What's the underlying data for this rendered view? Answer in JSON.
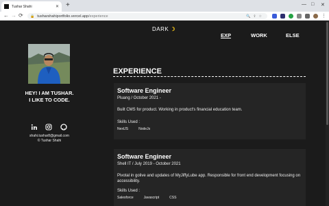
{
  "browser": {
    "tab_title": "Tushar Shahi",
    "tab_close": "✕",
    "new_tab": "+",
    "url_host": "tusharshahiportfolio.vercel.app",
    "url_path": "/experience",
    "back": "←",
    "forward": "→",
    "reload": "⟳"
  },
  "header": {
    "mode_label": "DARK",
    "mode_icon": "☽",
    "nav": [
      {
        "label": "EXP",
        "active": true
      },
      {
        "label": "WORK",
        "active": false
      },
      {
        "label": "ELSE",
        "active": false
      }
    ]
  },
  "profile": {
    "greeting_line1": "HEY! I AM TUSHAR.",
    "greeting_line2": "I LIKE TO CODE.",
    "email": "shahi.tushar8@gmail.com",
    "copyright": "© Tushar Shahi",
    "social": [
      "linkedin-icon",
      "instagram-icon",
      "github-icon"
    ]
  },
  "section": {
    "title": "EXPERIENCE"
  },
  "experience": [
    {
      "role": "Software Engineer",
      "meta": "Pluang / October 2021 -",
      "description": "Built CMS for product. Working in product's financial education team.",
      "skills_heading": "Skills Used :",
      "skills": [
        "NextJS",
        "NodeJs"
      ]
    },
    {
      "role": "Software Engineer",
      "meta": "Shell IT / July 2019 - October 2021",
      "description": "Pivotal in golive and updates of MyJiffyLube app. Responsible for front end development focusing on accessibility.",
      "skills_heading": "Skills Used :",
      "skills": [
        "Salesforce",
        "Javascript",
        "CSS"
      ]
    }
  ]
}
